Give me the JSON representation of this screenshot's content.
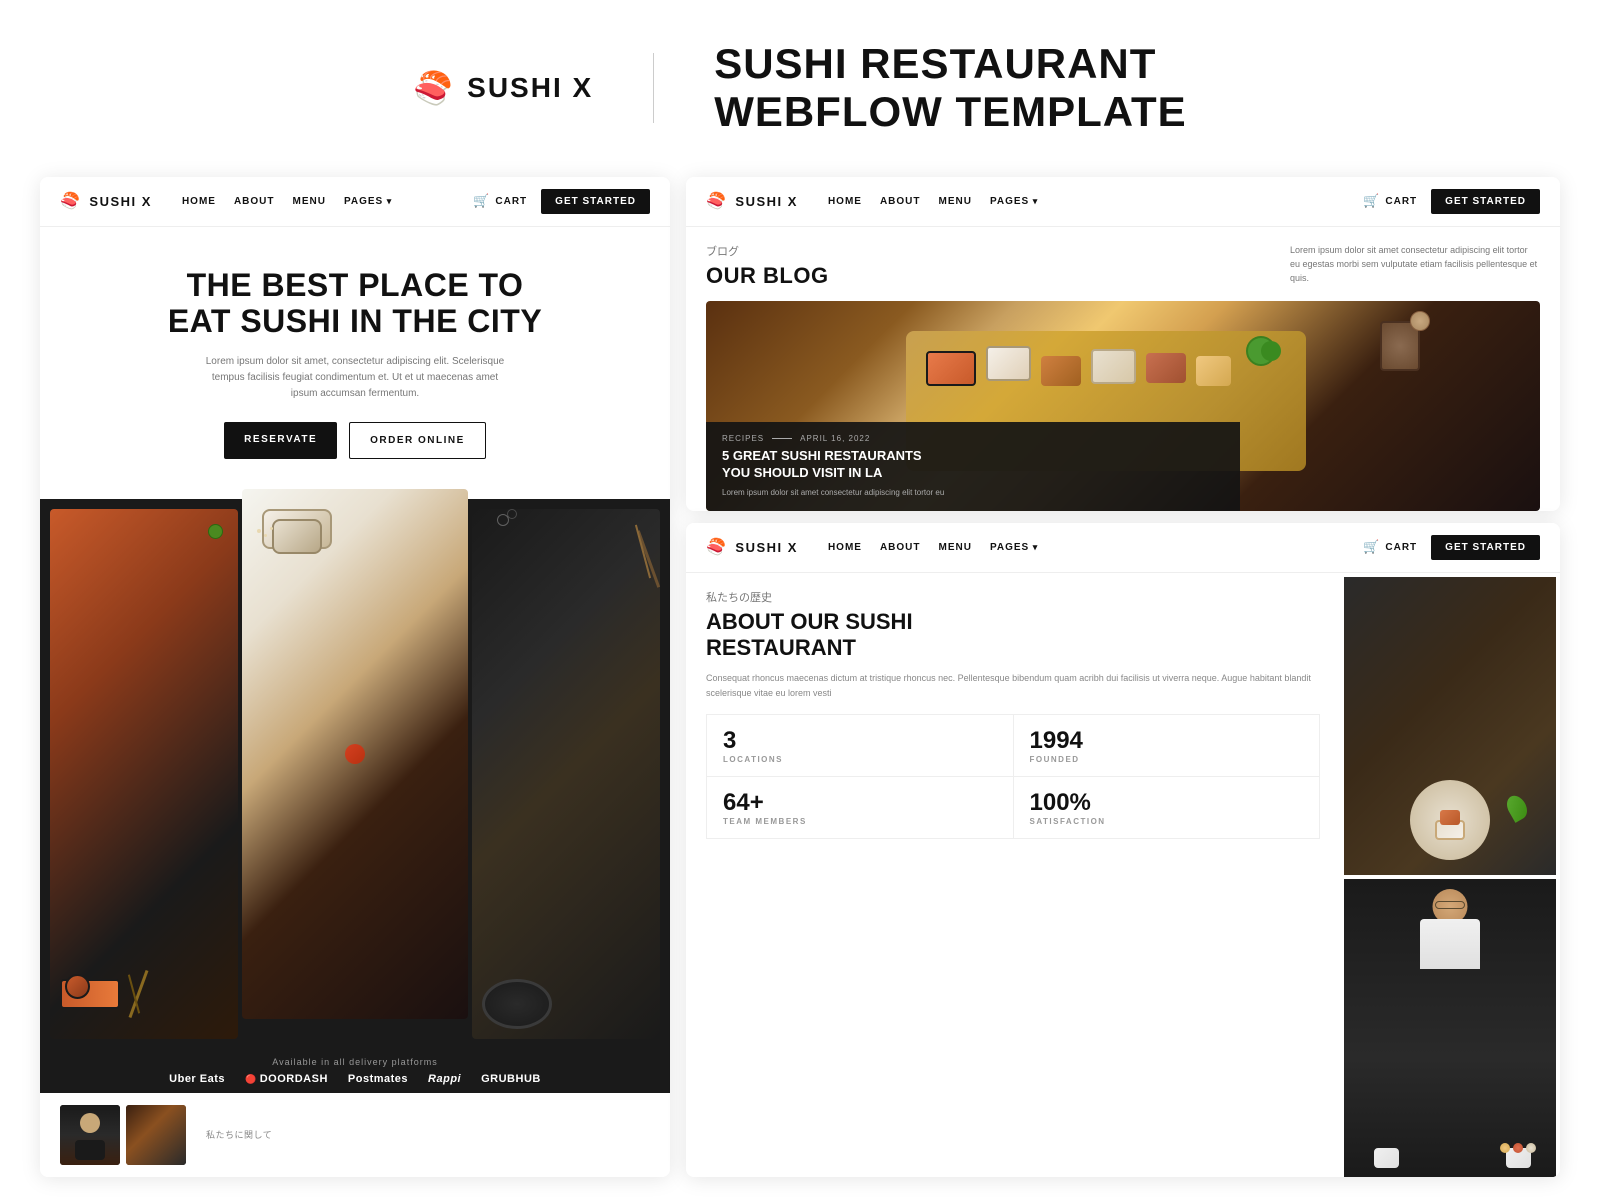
{
  "top_header": {
    "logo_icon": "🍣",
    "brand_name": "SUSHI X",
    "tagline_line1": "SUSHI RESTAURANT",
    "tagline_line2": "WEBFLOW TEMPLATE"
  },
  "nav": {
    "logo_icon": "🍣",
    "brand": "SUSHI X",
    "links": [
      "HOME",
      "ABOUT",
      "MENU",
      "PAGES"
    ],
    "cart_label": "CART",
    "cta_label": "GET STARTED"
  },
  "hero": {
    "title_line1": "THE BEST PLACE TO",
    "title_line2": "EAT SUSHI IN THE CITY",
    "subtitle": "Lorem ipsum dolor sit amet, consectetur adipiscing elit. Scelerisque tempus facilisis feugiat condimentum et. Ut et ut maecenas amet ipsum accumsan fermentum.",
    "btn1": "RESERVATE",
    "btn2": "ORDER ONLINE",
    "delivery_label": "Available in all delivery platforms",
    "delivery_brands": [
      "Uber Eats",
      "DOORDASH",
      "Postmates",
      "Rappi",
      "GRUBHUB"
    ]
  },
  "blog": {
    "japanese_label": "ブログ",
    "title": "OUR BLOG",
    "description": "Lorem ipsum dolor sit amet consectetur adipiscing elit tortor eu egestas morbi sem vulputate etiam facilisis pellentesque et quis.",
    "post": {
      "category": "RECIPES",
      "date": "APRIL 16, 2022",
      "title_line1": "5 GREAT SUSHI RESTAURANTS",
      "title_line2": "YOU SHOULD VISIT IN LA",
      "excerpt": "Lorem ipsum dolor sit amet consectetur adipiscing elit tortor eu"
    }
  },
  "about": {
    "japanese_label": "私たちの歴史",
    "title_line1": "ABOUT OUR SUSHI",
    "title_line2": "RESTAURANT",
    "text": "Consequat rhoncus maecenas dictum at tristique rhoncus nec. Pellentesque bibendum quam acribh dui facilisis ut viverra neque. Augue habitant blandit scelerisque vitae eu lorem vesti",
    "stats": [
      {
        "number": "3",
        "label": "LOCATIONS"
      },
      {
        "number": "1994",
        "label": "FOUNDED"
      },
      {
        "number": "64+",
        "label": "TEAM MEMBERS"
      },
      {
        "number": "100%",
        "label": "SATISFACTION"
      }
    ]
  },
  "bottom_strip": {
    "japanese_label": "私たちに関して"
  }
}
